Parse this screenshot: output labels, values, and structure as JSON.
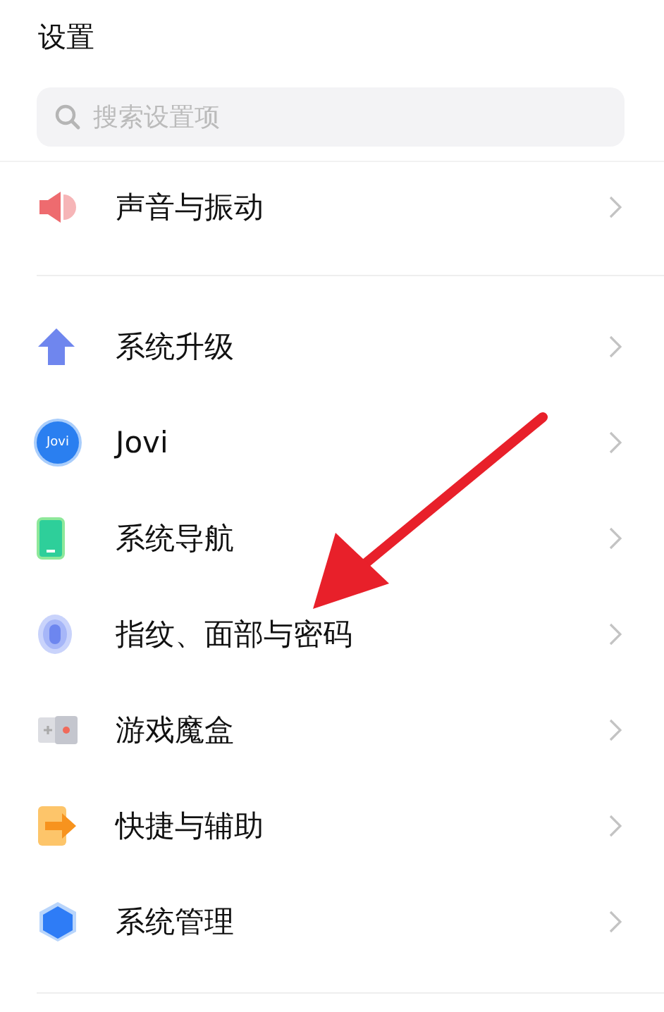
{
  "header": {
    "title": "设置"
  },
  "search": {
    "placeholder": "搜索设置项"
  },
  "groups": [
    {
      "items": [
        {
          "kind": "sound",
          "label": "声音与振动"
        }
      ]
    },
    {
      "items": [
        {
          "kind": "upgrade",
          "label": "系统升级"
        },
        {
          "kind": "jovi",
          "label": "Jovi",
          "icon_text": "Jovi"
        },
        {
          "kind": "phone",
          "label": "系统导航"
        },
        {
          "kind": "fingerprint",
          "label": "指纹、面部与密码"
        },
        {
          "kind": "game",
          "label": "游戏魔盒"
        },
        {
          "kind": "shortcut",
          "label": "快捷与辅助"
        },
        {
          "kind": "hexagon",
          "label": "系统管理"
        }
      ]
    }
  ],
  "annotation": {
    "kind": "arrow"
  }
}
